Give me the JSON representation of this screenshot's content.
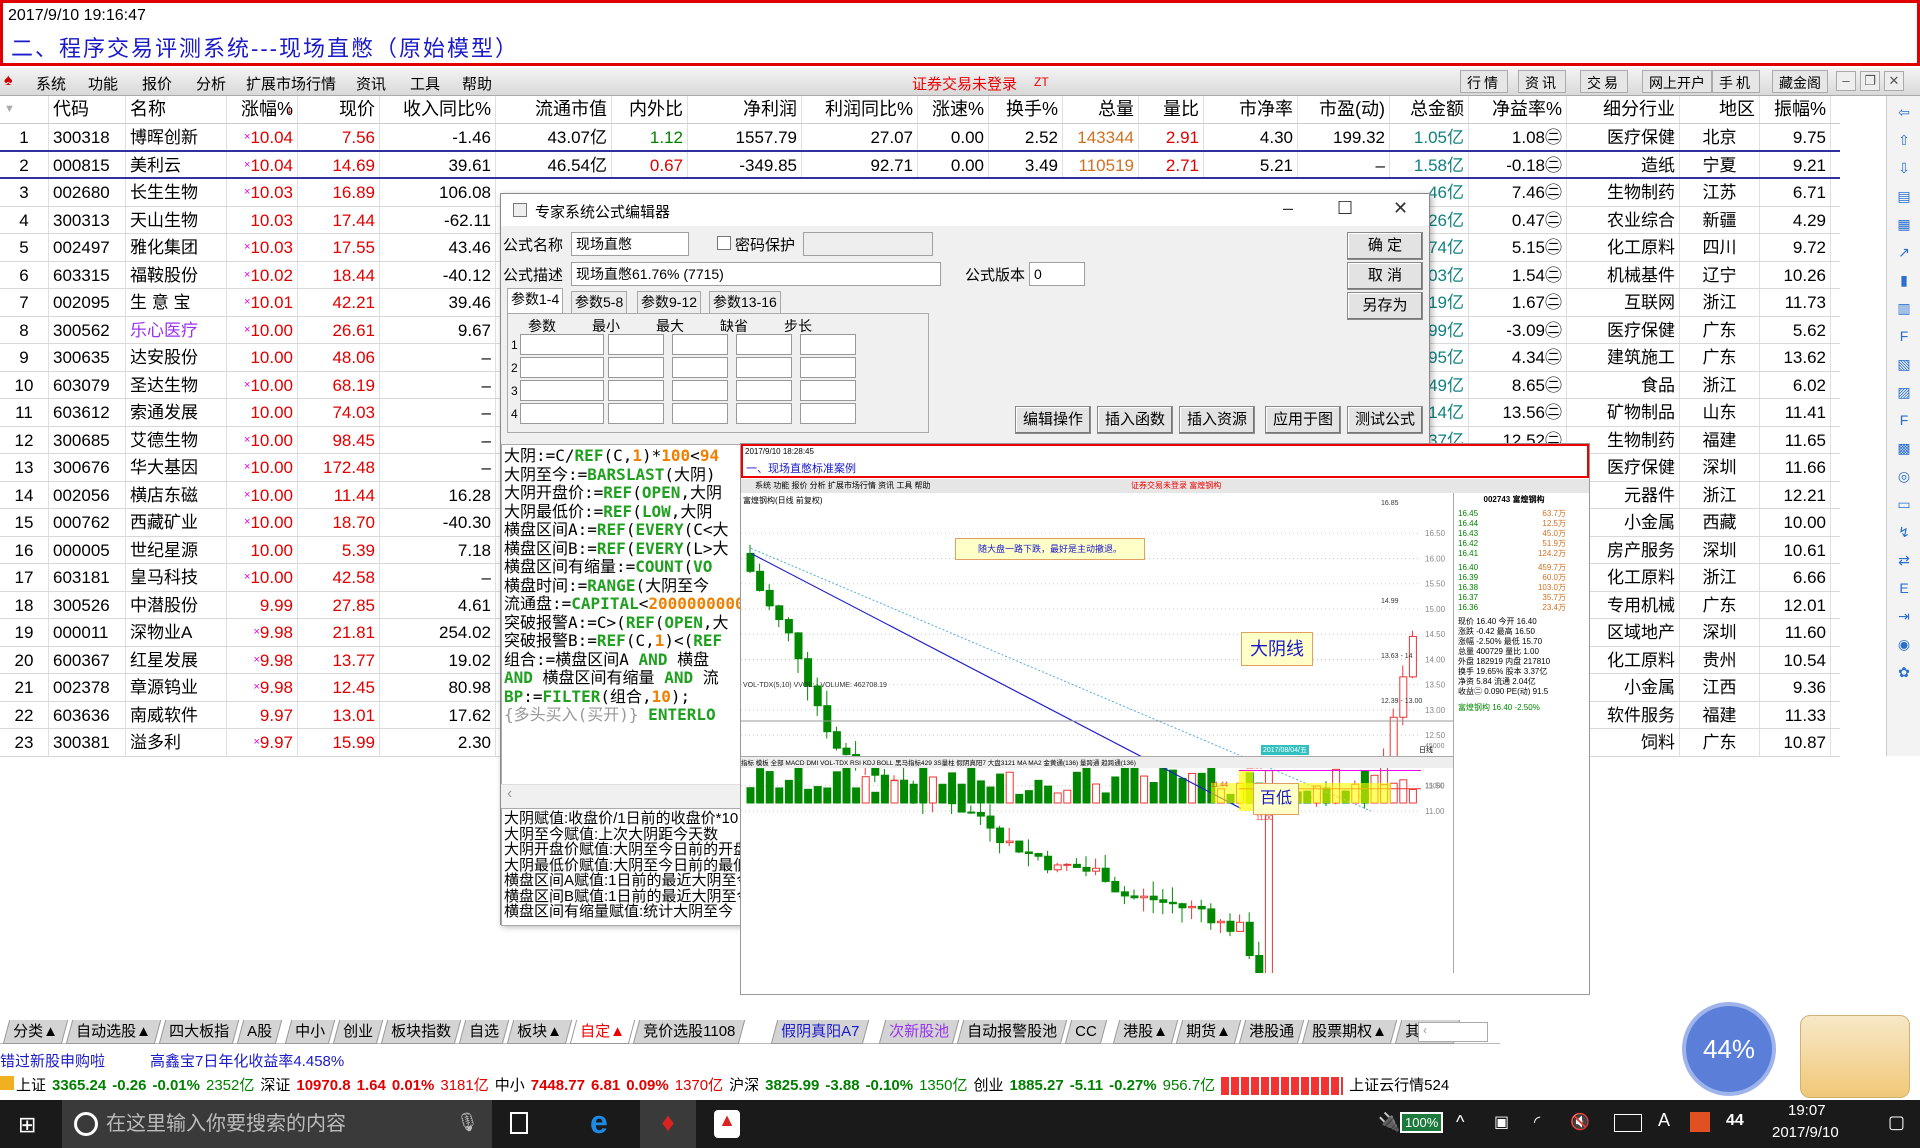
{
  "title_box": {
    "timestamp": "2017/9/10 19:16:47",
    "title": "二、程序交易评测系统---现场直憋（原始模型）"
  },
  "menu": {
    "items": [
      "系统",
      "功能",
      "报价",
      "分析",
      "扩展市场行情",
      "资讯",
      "工具",
      "帮助"
    ],
    "login_status": "证券交易未登录",
    "zt": "ZT",
    "right_buttons": [
      "行情",
      "资讯",
      "交易",
      "网上开户",
      "手机",
      "藏金阁"
    ],
    "window_controls": [
      "–",
      "❐",
      "✕"
    ]
  },
  "table": {
    "headers": [
      "",
      "代码",
      "名称",
      "涨幅%",
      "现价",
      "收入同比%",
      "流通市值",
      "内外比",
      "净利润",
      "利润同比%",
      "涨速%",
      "换手%",
      "总量",
      "量比",
      "市净率",
      "市盈(动)",
      "总金额",
      "净益率%",
      "细分行业",
      "地区",
      "振幅%"
    ],
    "sort_indicator": "↓",
    "rows": [
      {
        "no": "1",
        "code": "300318",
        "name": "博晖创新",
        "limit": true,
        "chg": "10.04",
        "price": "7.56",
        "rev": "-1.46",
        "mcap": "43.07亿",
        "io": "1.12",
        "np": "1557.79",
        "npy": "27.07",
        "spd": "0.00",
        "turn": "2.52",
        "vol": "143344",
        "vr": "2.91",
        "pb": "4.30",
        "pe": "199.32",
        "amt": "1.05亿",
        "roe": "1.08㊁",
        "ind": "医疗保健",
        "reg": "北京",
        "amp": "9.75"
      },
      {
        "no": "2",
        "code": "000815",
        "name": "美利云",
        "limit": true,
        "chg": "10.04",
        "price": "14.69",
        "rev": "39.61",
        "mcap": "46.54亿",
        "io": "0.67",
        "np": "-349.85",
        "npy": "92.71",
        "spd": "0.00",
        "turn": "3.49",
        "vol": "110519",
        "vr": "2.71",
        "pb": "5.21",
        "pe": "–",
        "amt": "1.58亿",
        "roe": "-0.18㊁",
        "ind": "造纸",
        "reg": "宁夏",
        "amp": "9.21"
      },
      {
        "no": "3",
        "code": "002680",
        "name": "长生生物",
        "limit": true,
        "chg": "10.03",
        "price": "16.89",
        "rev": "106.08",
        "amt": "46亿",
        "roe": "7.46㊁",
        "ind": "生物制药",
        "reg": "江苏",
        "amp": "6.71"
      },
      {
        "no": "4",
        "code": "300313",
        "name": "天山生物",
        "limit": false,
        "chg": "10.03",
        "price": "17.44",
        "rev": "-62.11",
        "amt": "26亿",
        "roe": "0.47㊁",
        "ind": "农业综合",
        "reg": "新疆",
        "amp": "4.29"
      },
      {
        "no": "5",
        "code": "002497",
        "name": "雅化集团",
        "limit": true,
        "chg": "10.03",
        "price": "17.55",
        "rev": "43.46",
        "amt": "74亿",
        "roe": "5.15㊁",
        "ind": "化工原料",
        "reg": "四川",
        "amp": "9.72"
      },
      {
        "no": "6",
        "code": "603315",
        "name": "福鞍股份",
        "limit": true,
        "chg": "10.02",
        "price": "18.44",
        "rev": "-40.12",
        "amt": "03亿",
        "roe": "1.54㊁",
        "ind": "机械基件",
        "reg": "辽宁",
        "amp": "10.26"
      },
      {
        "no": "7",
        "code": "002095",
        "name": "生 意 宝",
        "limit": true,
        "chg": "10.01",
        "price": "42.21",
        "rev": "39.46",
        "amt": "19亿",
        "roe": "1.67㊁",
        "ind": "互联网",
        "reg": "浙江",
        "amp": "11.73"
      },
      {
        "no": "8",
        "code": "300562",
        "name": "乐心医疗",
        "purple": true,
        "limit": true,
        "chg": "10.00",
        "price": "26.61",
        "rev": "9.67",
        "amt": "99亿",
        "roe": "-3.09㊁",
        "ind": "医疗保健",
        "reg": "广东",
        "amp": "5.62"
      },
      {
        "no": "9",
        "code": "300635",
        "name": "达安股份",
        "limit": false,
        "chg": "10.00",
        "price": "48.06",
        "rev": "–",
        "amt": "95亿",
        "roe": "4.34㊁",
        "ind": "建筑施工",
        "reg": "广东",
        "amp": "13.62"
      },
      {
        "no": "10",
        "code": "603079",
        "name": "圣达生物",
        "limit": true,
        "chg": "10.00",
        "price": "68.19",
        "rev": "–",
        "amt": "49亿",
        "roe": "8.65㊁",
        "ind": "食品",
        "reg": "浙江",
        "amp": "6.02"
      },
      {
        "no": "11",
        "code": "603612",
        "name": "索通发展",
        "limit": false,
        "chg": "10.00",
        "price": "74.03",
        "rev": "–",
        "amt": "14亿",
        "roe": "13.56㊁",
        "ind": "矿物制品",
        "reg": "山东",
        "amp": "11.41"
      },
      {
        "no": "12",
        "code": "300685",
        "name": "艾德生物",
        "limit": true,
        "chg": "10.00",
        "price": "98.45",
        "rev": "–",
        "amt": "37亿",
        "roe": "12.52㊁",
        "ind": "生物制药",
        "reg": "福建",
        "amp": "11.65"
      },
      {
        "no": "13",
        "code": "300676",
        "name": "华大基因",
        "limit": true,
        "chg": "10.00",
        "price": "172.48",
        "rev": "–",
        "ind": "医疗保健",
        "reg": "深圳",
        "amp": "11.66"
      },
      {
        "no": "14",
        "code": "002056",
        "name": "横店东磁",
        "limit": true,
        "chg": "10.00",
        "price": "11.44",
        "rev": "16.28",
        "ind": "元器件",
        "reg": "浙江",
        "amp": "12.21"
      },
      {
        "no": "15",
        "code": "000762",
        "name": "西藏矿业",
        "limit": true,
        "chg": "10.00",
        "price": "18.70",
        "rev": "-40.30",
        "ind": "小金属",
        "reg": "西藏",
        "amp": "10.00"
      },
      {
        "no": "16",
        "code": "000005",
        "name": "世纪星源",
        "limit": false,
        "chg": "10.00",
        "price": "5.39",
        "rev": "7.18",
        "ind": "房产服务",
        "reg": "深圳",
        "amp": "10.61"
      },
      {
        "no": "17",
        "code": "603181",
        "name": "皇马科技",
        "limit": true,
        "chg": "10.00",
        "price": "42.58",
        "rev": "–",
        "ind": "化工原料",
        "reg": "浙江",
        "amp": "6.66"
      },
      {
        "no": "18",
        "code": "300526",
        "name": "中潜股份",
        "limit": false,
        "chg": "9.99",
        "price": "27.85",
        "rev": "4.61",
        "ind": "专用机械",
        "reg": "广东",
        "amp": "12.01"
      },
      {
        "no": "19",
        "code": "000011",
        "name": "深物业A",
        "limit": true,
        "chg": "9.98",
        "price": "21.81",
        "rev": "254.02",
        "ind": "区域地产",
        "reg": "深圳",
        "amp": "11.60"
      },
      {
        "no": "20",
        "code": "600367",
        "name": "红星发展",
        "limit": true,
        "chg": "9.98",
        "price": "13.77",
        "rev": "19.02",
        "ind": "化工原料",
        "reg": "贵州",
        "amp": "10.54"
      },
      {
        "no": "21",
        "code": "002378",
        "name": "章源钨业",
        "limit": true,
        "chg": "9.98",
        "price": "12.45",
        "rev": "80.98",
        "ind": "小金属",
        "reg": "江西",
        "amp": "9.36"
      },
      {
        "no": "22",
        "code": "603636",
        "name": "南威软件",
        "limit": false,
        "chg": "9.97",
        "price": "13.01",
        "rev": "17.62",
        "ind": "软件服务",
        "reg": "福建",
        "amp": "11.33"
      },
      {
        "no": "23",
        "code": "300381",
        "name": "溢多利",
        "limit": true,
        "chg": "9.97",
        "price": "15.99",
        "rev": "2.30",
        "ind": "饲料",
        "reg": "广东",
        "amp": "10.87"
      }
    ],
    "limit_mark": "×"
  },
  "dialog": {
    "title": "专家系统公式编辑器",
    "name_label": "公式名称",
    "name_value": "现场直憋",
    "password_label": "密码保护",
    "desc_label": "公式描述",
    "desc_value": "现场直憋61.76% (7715)",
    "version_label": "公式版本",
    "version_value": "0",
    "ok": "确  定",
    "cancel": "取  消",
    "save_as": "另存为",
    "tabs": [
      "参数1-4",
      "参数5-8",
      "参数9-12",
      "参数13-16"
    ],
    "param_headers": [
      "参数",
      "最小",
      "最大",
      "缺省",
      "步长"
    ],
    "param_rows": [
      "1",
      "2",
      "3",
      "4"
    ],
    "actions": [
      "编辑操作",
      "插入函数",
      "插入资源",
      "应用于图",
      "测试公式"
    ],
    "code_lines": [
      "大阴:=C/REF(C,1)*100<94",
      "大阴至今:=BARSLAST(大阴)",
      "大阴开盘价:=REF(OPEN,大阴",
      "大阴最低价:=REF(LOW,大阴",
      "横盘区间A:=REF(EVERY(C<大",
      "横盘区间B:=REF(EVERY(L>大",
      "横盘区间有缩量:=COUNT(VO",
      "横盘时间:=RANGE(大阴至今",
      "流通盘:=CAPITAL<2000000000",
      "突破报警A:=C>(REF(OPEN,大",
      "突破报警B:=REF(C,1)<(REF",
      "组合:=横盘区间A AND 横盘",
      "AND 横盘区间有缩量 AND 流",
      "BP:=FILTER(组合,10);",
      "{多头买入(买开)} ENTERLO"
    ],
    "desc_lines": [
      "大阴赋值:收盘价/1日前的收盘价*10",
      "大阴至今赋值:上次大阴距今天数",
      "大阴开盘价赋值:大阴至今日前的开盘",
      "大阴最低价赋值:大阴至今日前的最低",
      "横盘区间A赋值:1日前的最近大阴至今",
      "横盘区间B赋值:1日前的最近大阴至今",
      "横盘区间有缩量赋值:统计大阴至今"
    ]
  },
  "embedded": {
    "timestamp": "2017/9/10 18:28:45",
    "title": "一、现场直憋标准案例",
    "menu": "系统  功能  报价  分析  扩展市场行情  资讯  工具  帮助",
    "login_status": "证券交易未登录  富煌钢构",
    "chart_title": "富煌钢构(日线 前复权)",
    "annotation1": "随大盘一路下跌，最好是主动撤退。",
    "annotation2": "大阴线",
    "annotation3": "百低",
    "price_ticks": [
      "16.50",
      "16.00",
      "15.50",
      "15.00",
      "14.50",
      "14.00",
      "13.50",
      "13.00",
      "12.50",
      "12.00",
      "11.50",
      "11.00"
    ],
    "price_labels": [
      "16.85",
      "14.99",
      "13.63 - 14",
      "12.39 - 13.00",
      "11.44",
      "11.80",
      "11.00"
    ],
    "vol_title": "VOL-TDX(5,10) VVOL: -  VOLUME: 462708.19",
    "vol_ticks": [
      "45000",
      "30000",
      "15000"
    ],
    "date_label": "2017/08/04/五",
    "period": "日线",
    "indicator_tabs": "指标 模板 全部 MACD DMI VOL-TDX RSI KDJ BOLL 黑马指标429 3S量柱 假阴真阳7 大盘3121 MA MA2 金黄通(136) 量跨通 趋跨通(136)",
    "quote": {
      "title": "002743 富煌钢构",
      "asks": [
        [
          "16.45",
          "63.7万"
        ],
        [
          "16.44",
          "12.5万"
        ],
        [
          "16.43",
          "45.0万"
        ],
        [
          "16.42",
          "51.9万"
        ],
        [
          "16.41",
          "124.2万"
        ]
      ],
      "bids": [
        [
          "16.40",
          "459.7万"
        ],
        [
          "16.39",
          "60.0万"
        ],
        [
          "16.38",
          "103.0万"
        ],
        [
          "16.37",
          "35.7万"
        ],
        [
          "16.36",
          "23.4万"
        ]
      ],
      "stats": [
        "现价 16.40 今开 16.40",
        "涨跌 -0.42 最高 16.50",
        "涨幅 -2.50% 最低 15.70",
        "总量 400729 量比 1.00",
        "外盘 182919 内盘 217810",
        "换手 19.65% 股本 3.37亿",
        "净资 5.84 流通 2.04亿",
        "收益㊁ 0.090 PE(动) 91.5"
      ],
      "mini_title": "富煌钢构 16.40 -2.50%"
    }
  },
  "bottom_tabs": [
    {
      "label": "分类▲"
    },
    {
      "label": "自动选股▲"
    },
    {
      "label": "四大板指"
    },
    {
      "label": "A股"
    },
    {
      "label": "中小"
    },
    {
      "label": "创业"
    },
    {
      "label": "板块指数"
    },
    {
      "label": "自选"
    },
    {
      "label": "板块▲"
    },
    {
      "label": "自定▲",
      "active": true
    },
    {
      "label": "竞价选股1108"
    },
    {
      "label": "假阴真阳A7",
      "color": "#1a1ad0"
    },
    {
      "label": "次新股池",
      "color": "#9933ee"
    },
    {
      "label": "自动报警股池"
    },
    {
      "label": "CC"
    },
    {
      "label": "港股▲"
    },
    {
      "label": "期货▲"
    },
    {
      "label": "港股通"
    },
    {
      "label": "股票期权▲"
    },
    {
      "label": "其它▲"
    }
  ],
  "news": [
    "错过新股申购啦",
    "高鑫宝7日年化收益率4.458%"
  ],
  "indices": [
    {
      "name": "上证",
      "value": "3365.24",
      "chg": "-0.26",
      "pct": "-0.01%",
      "amt": "2352亿",
      "color": "#008000"
    },
    {
      "name": "深证",
      "value": "10970.8",
      "chg": "1.64",
      "pct": "0.01%",
      "amt": "3181亿",
      "color": "#e00000"
    },
    {
      "name": "中小",
      "value": "7448.77",
      "chg": "6.81",
      "pct": "0.09%",
      "amt": "1370亿",
      "color": "#e00000"
    },
    {
      "name": "沪深",
      "value": "3825.99",
      "chg": "-3.88",
      "pct": "-0.10%",
      "amt": "1350亿",
      "color": "#008000"
    },
    {
      "name": "创业",
      "value": "1885.27",
      "chg": "-5.11",
      "pct": "-0.27%",
      "amt": "956.7亿",
      "color": "#008000"
    }
  ],
  "cloud_status": "上证云行情524",
  "gauge": {
    "value": 44,
    "label": "44%"
  },
  "taskbar": {
    "search_placeholder": "在这里输入你要搜索的内容",
    "battery": "100%",
    "notif_count": "44",
    "time": "19:07",
    "date": "2017/9/10"
  }
}
